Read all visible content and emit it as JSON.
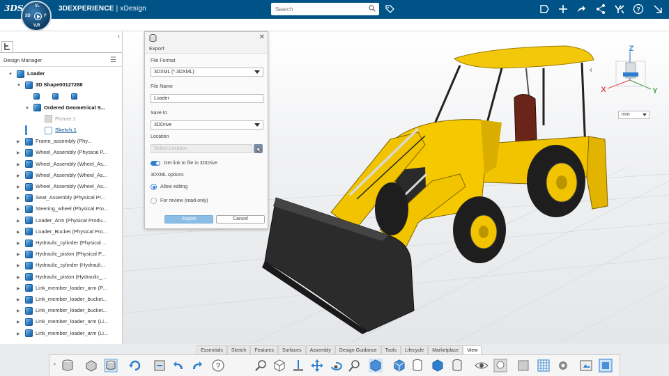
{
  "app": {
    "logo_text": "3DS",
    "brand_bold": "3DEXPERIENCE",
    "brand_rest": " | xDesign",
    "compass": {
      "top": "V₆",
      "left": "3D",
      "right": "i²",
      "bottom": "V,R"
    }
  },
  "search": {
    "placeholder": "Search"
  },
  "left_panel": {
    "title": "Design Manager",
    "tree": [
      {
        "label": "Loader",
        "style": "bold",
        "arrow": "▼"
      },
      {
        "label": "3D Shape00127288",
        "style": "bold",
        "arrow": "▼"
      },
      {
        "label": "",
        "style": "icons",
        "arrow": ""
      },
      {
        "label": "Ordered Geometrical S...",
        "style": "bold",
        "arrow": "▼"
      },
      {
        "label": "Picture.1",
        "style": "dim",
        "arrow": ""
      },
      {
        "label": "Sketch.1",
        "style": "ul",
        "arrow": ""
      },
      {
        "label": "Frame_assembly (Phy...",
        "style": "",
        "arrow": "▶"
      },
      {
        "label": "Wheel_Assembly (Physical P...",
        "style": "",
        "arrow": "▶"
      },
      {
        "label": "Wheel_Assembly (Wheel_As...",
        "style": "",
        "arrow": "▶"
      },
      {
        "label": "Wheel_Assembly (Wheel_As...",
        "style": "",
        "arrow": "▶"
      },
      {
        "label": "Wheel_Assembly (Wheel_As...",
        "style": "",
        "arrow": "▶"
      },
      {
        "label": "Seat_Assembly (Physical Pr...",
        "style": "",
        "arrow": "▶"
      },
      {
        "label": "Steering_wheel (Physical Pro...",
        "style": "",
        "arrow": "▶"
      },
      {
        "label": "Loader_Arm (Physical Produ...",
        "style": "",
        "arrow": "▶"
      },
      {
        "label": "Loader_Bucket (Physical Pro...",
        "style": "",
        "arrow": "▶"
      },
      {
        "label": "Hydraulic_cylinder (Physical ...",
        "style": "",
        "arrow": "▶"
      },
      {
        "label": "Hydraulic_piston (Physical P...",
        "style": "",
        "arrow": "▶"
      },
      {
        "label": "Hydraulic_cylinder (Hydrauli...",
        "style": "",
        "arrow": "▶"
      },
      {
        "label": "Hydraulic_piston (Hydraulic_...",
        "style": "",
        "arrow": "▶"
      },
      {
        "label": "Link_member_loader_arm (P...",
        "style": "",
        "arrow": "▶"
      },
      {
        "label": "Link_member_loader_bucket...",
        "style": "",
        "arrow": "▶"
      },
      {
        "label": "Link_member_loader_bucket...",
        "style": "",
        "arrow": "▶"
      },
      {
        "label": "Link_member_loader_arm (Li...",
        "style": "",
        "arrow": "▶"
      },
      {
        "label": "Link_member_loader_arm (Li...",
        "style": "",
        "arrow": "▶"
      }
    ]
  },
  "export_dialog": {
    "title": "Export",
    "file_format_label": "File Format",
    "file_format_value": "3DXML (*.3DXML)",
    "file_name_label": "File Name",
    "file_name_value": "Loader",
    "save_to_label": "Save to",
    "save_to_value": "3DDrive",
    "location_label": "Location",
    "location_placeholder": "Select Location",
    "link_toggle_label": "Get link to file in 3DDrive",
    "options_label": "3DXML options",
    "option_allow_editing": "Allow editing",
    "option_for_review": "For review (read-only)",
    "export_button": "Export",
    "cancel_button": "Cancel"
  },
  "viewport": {
    "axes": {
      "z": "Z",
      "x": "X",
      "y": "Y"
    },
    "units_value": "mm"
  },
  "bottom_tabs": [
    "Essentials",
    "Sketch",
    "Features",
    "Surfaces",
    "Assembly",
    "Design Guidance",
    "Tools",
    "Lifecycle",
    "Marketplace",
    "View"
  ],
  "active_tab": "View",
  "colors": {
    "topbar": "#005386",
    "accent": "#2f7fd0",
    "loader_yellow": "#f2c400"
  }
}
